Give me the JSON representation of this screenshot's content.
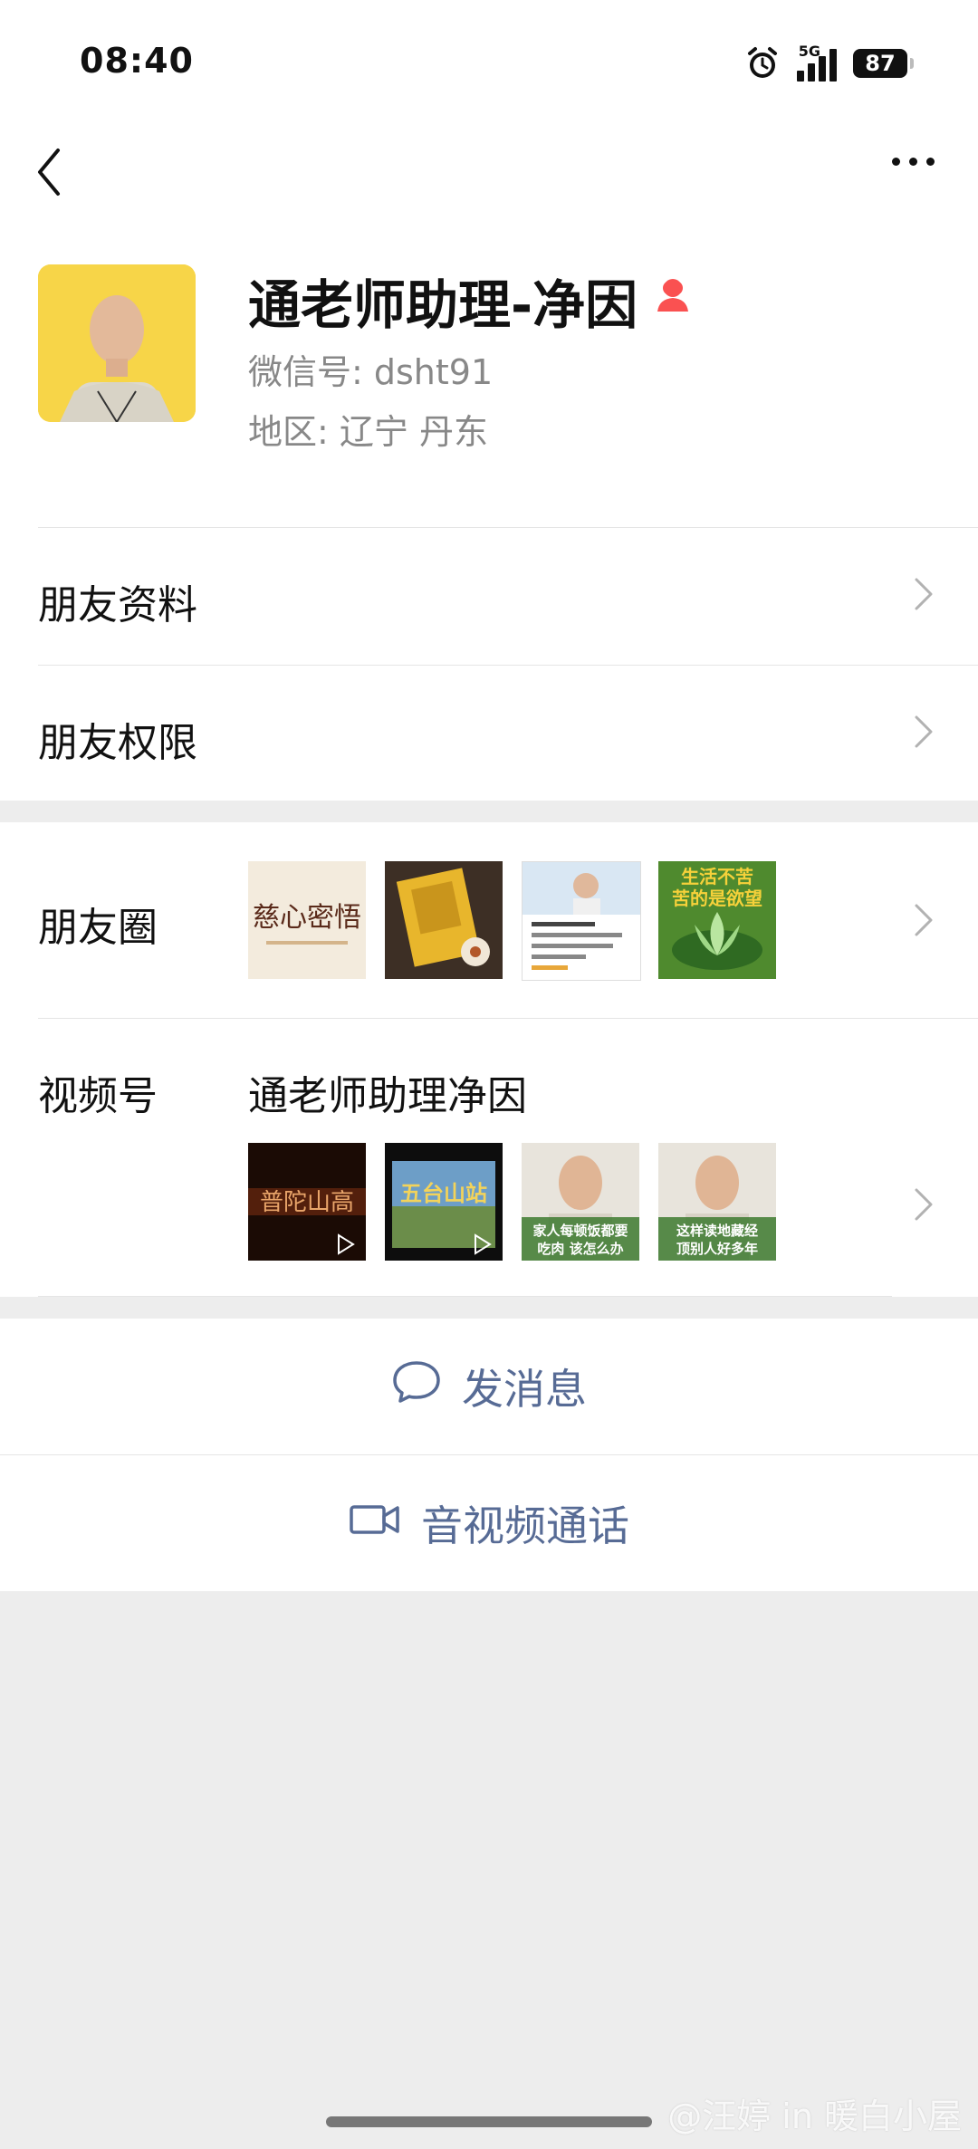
{
  "status_bar": {
    "time": "08:40",
    "network": "5G",
    "battery": "87",
    "icons": [
      "alarm-icon",
      "signal-icon",
      "battery-icon"
    ]
  },
  "nav": {
    "back_icon": "chevron-left-icon",
    "more_icon": "more-dots-icon"
  },
  "profile": {
    "name": "通老师助理-净因",
    "gender_icon": "female-icon",
    "wechat_id": "微信号: dsht91",
    "region": "地区: 辽宁  丹东",
    "avatar_bg": "#f7d548"
  },
  "rows": {
    "friend_info": "朋友资料",
    "friend_permissions": "朋友权限",
    "moments": "朋友圈",
    "channels": "视频号",
    "channels_name": "通老师助理净因"
  },
  "moments_thumbs": [
    {
      "text": "慈心密悟",
      "kind": "calligraphy"
    },
    {
      "text": "",
      "kind": "book"
    },
    {
      "text": "",
      "kind": "screenshot"
    },
    {
      "text": "生活不苦 苦的是欲望",
      "kind": "lotus"
    }
  ],
  "channels_thumbs": [
    {
      "text": "普陀山高",
      "kind": "video"
    },
    {
      "text": "五台山站",
      "kind": "video"
    },
    {
      "text": "家人每顿饭都要 吃肉 该怎么办",
      "kind": "portrait"
    },
    {
      "text": "这样读地藏经 顶别人好多年",
      "kind": "portrait"
    }
  ],
  "actions": {
    "message": "发消息",
    "call": "音视频通话"
  },
  "watermark": "@汪婷 in 暖白小屋",
  "colors": {
    "link": "#576b95",
    "background": "#ededed",
    "female_icon": "#fa5151"
  }
}
